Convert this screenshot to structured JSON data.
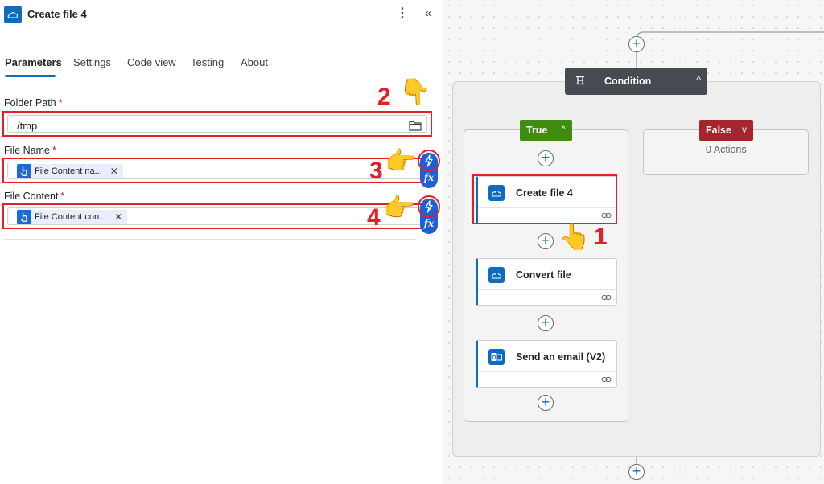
{
  "panel": {
    "title": "Create file 4",
    "more_label": "⋮",
    "collapse_label": "«",
    "tabs": [
      {
        "label": "Parameters",
        "active": true
      },
      {
        "label": "Settings",
        "active": false
      },
      {
        "label": "Code view",
        "active": false
      },
      {
        "label": "Testing",
        "active": false
      },
      {
        "label": "About",
        "active": false
      }
    ],
    "fields": {
      "folder_path": {
        "label": "Folder Path",
        "required": "*",
        "value": "/tmp"
      },
      "file_name": {
        "label": "File Name",
        "required": "*",
        "token": "File Content na...",
        "token_remove": "✕"
      },
      "file_content": {
        "label": "File Content",
        "required": "*",
        "token": "File Content con...",
        "token_remove": "✕"
      }
    },
    "fx_label": "fx",
    "annotations": [
      "2",
      "3",
      "4"
    ]
  },
  "canvas": {
    "condition": {
      "title": "Condition",
      "chevron": "^"
    },
    "true_branch": {
      "label": "True",
      "chevron": "^"
    },
    "false_branch": {
      "label": "False",
      "chevron": "v",
      "empty_text": "0 Actions"
    },
    "cards": [
      {
        "title": "Create file 4",
        "icon": "onedrive-icon"
      },
      {
        "title": "Convert file",
        "icon": "onedrive-icon"
      },
      {
        "title": "Send an email (V2)",
        "icon": "outlook-icon"
      }
    ],
    "add_label": "+",
    "annotation": "1"
  },
  "colors": {
    "accent": "#0f6cbd",
    "annotation_red": "#e3202a",
    "true_green": "#3f8c10",
    "false_red": "#a4262c",
    "condition_header": "#474b51"
  }
}
